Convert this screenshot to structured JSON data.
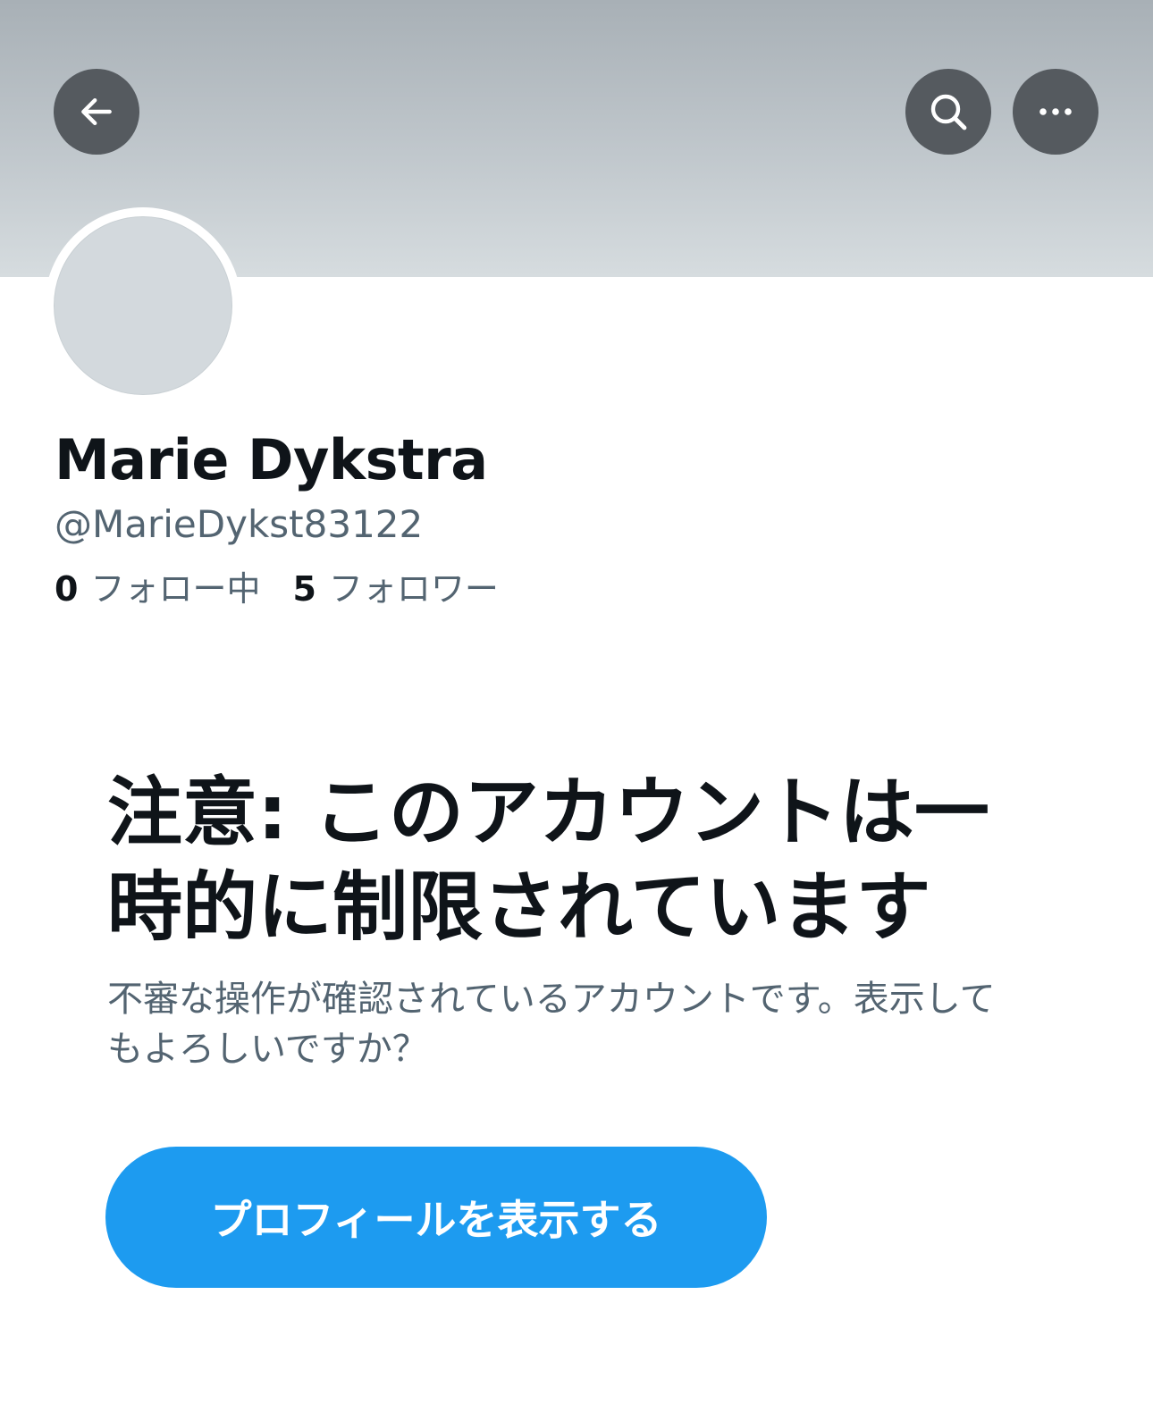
{
  "header": {
    "back_icon": "arrow-left-icon",
    "search_icon": "search-icon",
    "more_icon": "more-horizontal-icon",
    "banner_color": "#b8c0c5",
    "button_color": "#555a5f"
  },
  "profile": {
    "display_name": "Marie Dykstra",
    "handle": "@MarieDykst83122",
    "following_count": "0",
    "following_label": "フォロー中",
    "followers_count": "5",
    "followers_label": "フォロワー",
    "avatar_color": "#d3d9dd"
  },
  "warning": {
    "title": "注意: このアカウントは一時的に制限されています",
    "body": "不審な操作が確認されているアカウントです。表示してもよろしいですか？",
    "button_label": "プロフィールを表示する",
    "button_color": "#1d9bf0"
  }
}
